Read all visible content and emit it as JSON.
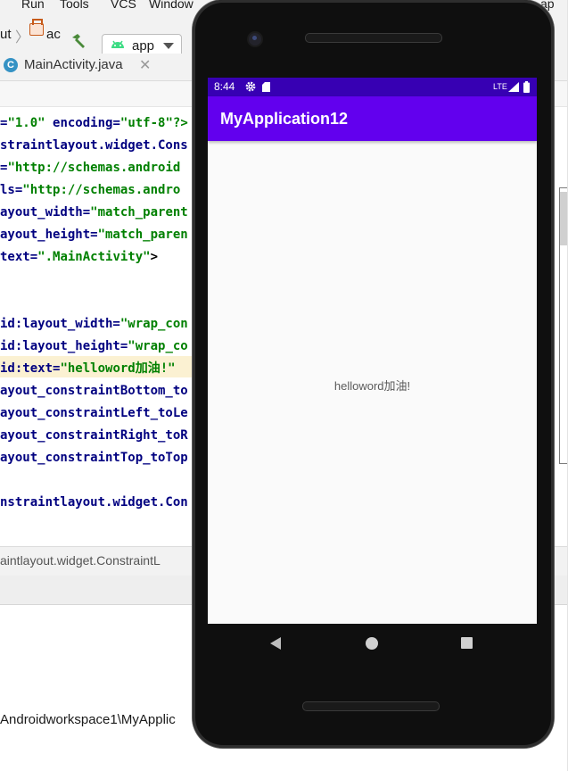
{
  "ide": {
    "menu": {
      "run": "Run",
      "tools": "Tools",
      "vcs": "VCS",
      "window": "Window",
      "cut": "ap"
    },
    "toolbar": {
      "crumb_left": "ut",
      "crumb_file": "ac",
      "run_config": "app"
    },
    "tab": {
      "icon_letter": "C",
      "label": "MainActivity.java",
      "close": "✕"
    },
    "code_lines": [
      {
        "a": "=",
        "s": "\"1.0\"",
        "b": " encoding=",
        "t": "\"utf-8\"?>"
      },
      {
        "tag": "straintlayout.widget.Cons"
      },
      {
        "a": "=",
        "s": "\"http://schemas.android"
      },
      {
        "a": "ls=",
        "s": "\"http://schemas.andro"
      },
      {
        "a": "ayout_width=",
        "s": "\"match_parent"
      },
      {
        "a": "ayout_height=",
        "s": "\"match_paren"
      },
      {
        "a": "text=",
        "s": "\".MainActivity\"",
        "p": ">"
      },
      {
        "a": "id:layout_width=",
        "s": "\"wrap_con"
      },
      {
        "a": "id:layout_height=",
        "s": "\"wrap_co"
      },
      {
        "a": "id:text=",
        "s": "\"helloword加油!\""
      },
      {
        "a": "ayout_constraintBottom_to"
      },
      {
        "a": "ayout_constraintLeft_toLe"
      },
      {
        "a": "ayout_constraintRight_toR"
      },
      {
        "a": "ayout_constraintTop_toTop"
      },
      {
        "tag": "nstraintlayout.widget.Con"
      }
    ],
    "breadcrumb": "aintlayout.widget.ConstraintL",
    "project_path": "Androidworkspace1\\MyApplic"
  },
  "phone": {
    "status": {
      "time": "8:44",
      "network": "LTE"
    },
    "app_title": "MyApplication12",
    "content_text": "helloword加油!"
  }
}
